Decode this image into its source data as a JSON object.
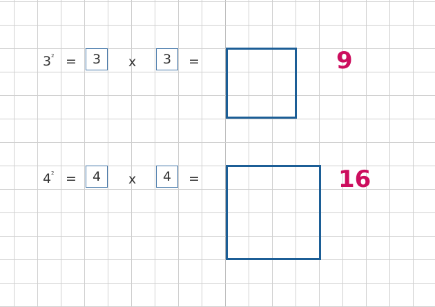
{
  "rows": [
    {
      "base": "3",
      "exponent": "2",
      "equals_1": "=",
      "factor_1": "3",
      "times": "x",
      "factor_2": "3",
      "equals_2": "=",
      "result": "9"
    },
    {
      "base": "4",
      "exponent": "2",
      "equals_1": "=",
      "factor_1": "4",
      "times": "x",
      "factor_2": "4",
      "equals_2": "=",
      "result": "16"
    }
  ],
  "colors": {
    "grid_line": "#cfcfcf",
    "grid_line_heavy": "#b8b8b8",
    "box_border": "#3f73a6",
    "square_border": "#1c5e96",
    "result": "#cc0e5e",
    "text": "#333333"
  }
}
